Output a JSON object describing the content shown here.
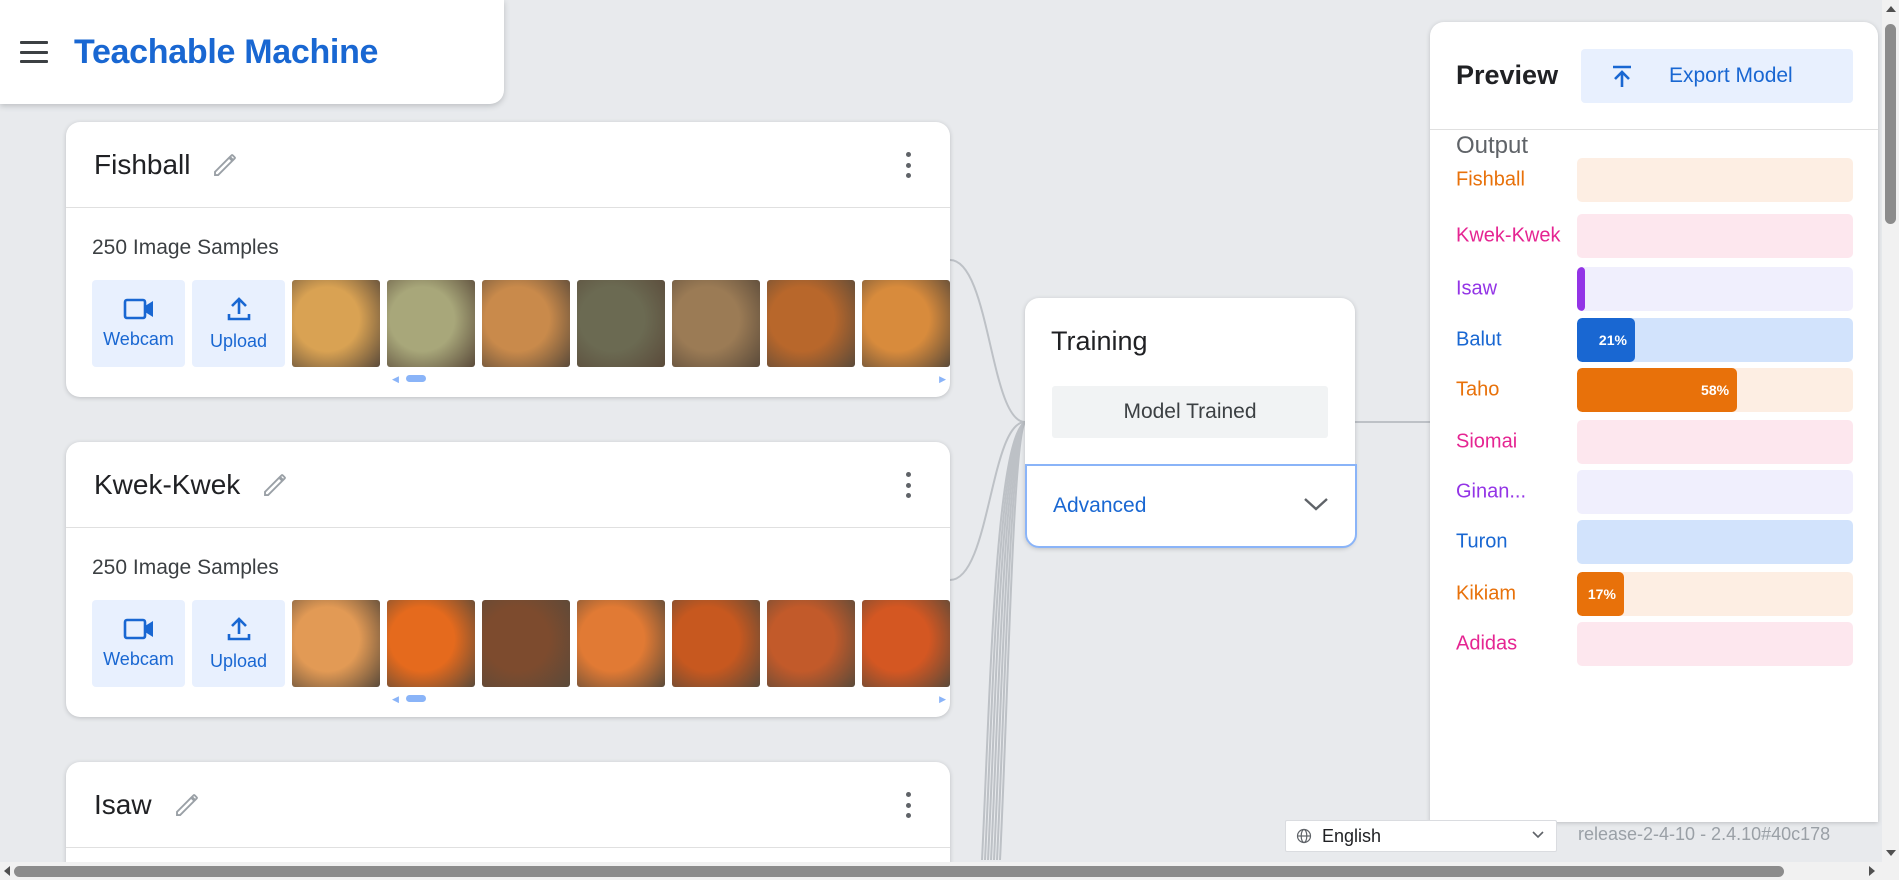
{
  "header": {
    "title": "Teachable Machine"
  },
  "classes": [
    {
      "name": "Fishball",
      "sample_count": "250 Image Samples",
      "webcam_label": "Webcam",
      "upload_label": "Upload",
      "thumb_colors": [
        "#d9a253",
        "#a8a77a",
        "#c98a4b",
        "#6b6a52",
        "#9b7b55",
        "#b8672b",
        "#d88b3c"
      ]
    },
    {
      "name": "Kwek-Kwek",
      "sample_count": "250 Image Samples",
      "webcam_label": "Webcam",
      "upload_label": "Upload",
      "thumb_colors": [
        "#e29a55",
        "#e56a1d",
        "#7d4b2e",
        "#e17a34",
        "#c7581f",
        "#c25a2a",
        "#d45722"
      ]
    },
    {
      "name": "Isaw"
    }
  ],
  "training": {
    "title": "Training",
    "button_label": "Model Trained",
    "advanced_label": "Advanced"
  },
  "preview": {
    "title": "Preview",
    "export_label": "Export Model",
    "output_label": "Output",
    "outputs": [
      {
        "name": "Fishball",
        "color": "#e8710a",
        "track": "#fdeee3",
        "value": 0,
        "label": ""
      },
      {
        "name": "Kwek-Kwek",
        "color": "#e52592",
        "track": "#fde7ee",
        "value": 0,
        "label": ""
      },
      {
        "name": "Isaw",
        "color": "#9334e6",
        "track": "#f0effd",
        "value": 2,
        "label": ""
      },
      {
        "name": "Balut",
        "color": "#1967d2",
        "track": "#d2e3fc",
        "value": 21,
        "label": "21%"
      },
      {
        "name": "Taho",
        "color": "#e8710a",
        "track": "#fdeee3",
        "value": 58,
        "label": "58%"
      },
      {
        "name": "Siomai",
        "color": "#e52592",
        "track": "#fde7ee",
        "value": 0,
        "label": ""
      },
      {
        "name": "Ginan...",
        "color": "#9334e6",
        "track": "#f0effd",
        "value": 0,
        "label": ""
      },
      {
        "name": "Turon",
        "color": "#1967d2",
        "track": "#d2e3fc",
        "value": 0,
        "label": ""
      },
      {
        "name": "Kikiam",
        "color": "#e8710a",
        "track": "#fdeee3",
        "value": 17,
        "label": "17%"
      },
      {
        "name": "Adidas",
        "color": "#e52592",
        "track": "#fde7ee",
        "value": 0,
        "label": ""
      }
    ]
  },
  "footer": {
    "language": "English",
    "version": "release-2-4-10 - 2.4.10#40c178"
  }
}
